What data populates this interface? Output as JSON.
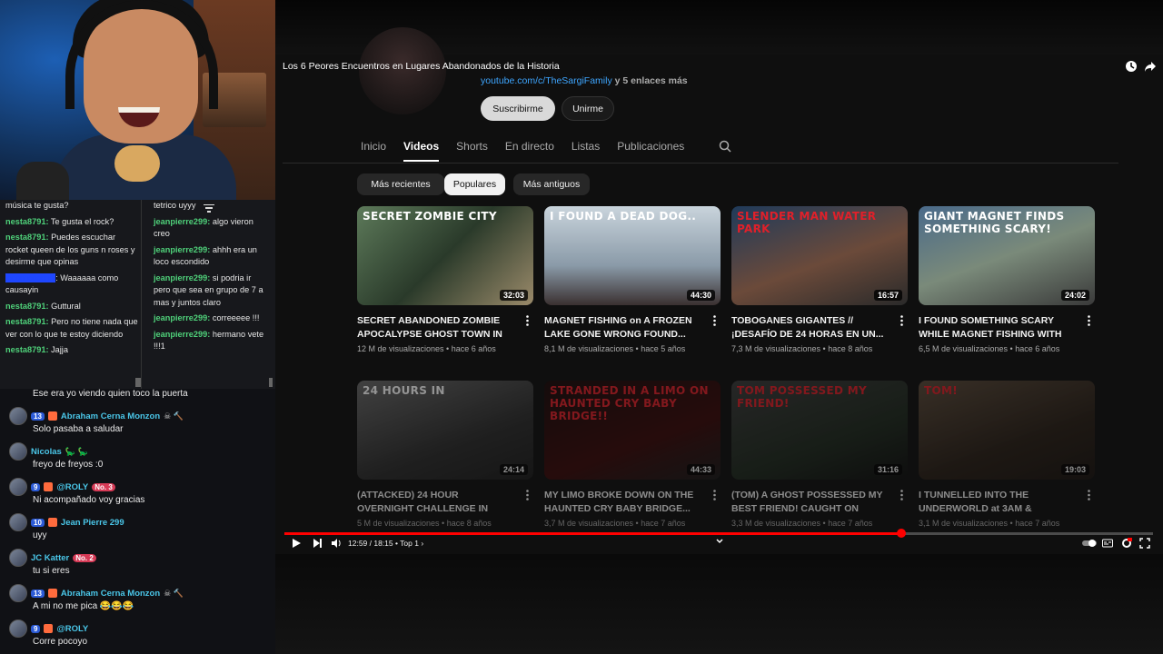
{
  "chat_top": {
    "left": [
      {
        "user": "",
        "text": "música te gusta?"
      },
      {
        "user": "nesta8791:",
        "text": "Te gusta el rock?"
      },
      {
        "user": "nesta8791:",
        "text": "Puedes escuchar rocket queen de los guns n roses y desirme que opinas"
      },
      {
        "user": "",
        "text": "Waaaaaa como causayin",
        "hidden_user": "xxxxxxxxxxxx"
      },
      {
        "user": "nesta8791:",
        "text": "Guttural"
      },
      {
        "user": "nesta8791:",
        "text": "Pero no tiene nada que ver con lo que te estoy diciendo"
      },
      {
        "user": "nesta8791:",
        "text": "Jajja"
      }
    ],
    "right": [
      {
        "user": "",
        "text": "tetrico uyyy"
      },
      {
        "user": "jeanpierre299:",
        "text": "algo vieron creo"
      },
      {
        "user": "jeanpierre299:",
        "text": "ahhh era un loco escondido"
      },
      {
        "user": "jeanpierre299:",
        "text": "si podria ir pero que sea en grupo de 7 a mas y juntos claro"
      },
      {
        "user": "jeanpierre299:",
        "text": "correeeee !!!"
      },
      {
        "user": "jeanpierre299:",
        "text": "hermano vete !!!1"
      }
    ]
  },
  "chat_bottom": {
    "first_line": "Ese era yo viendo quien toco la puerta",
    "messages": [
      {
        "level": "13",
        "name": "Abraham Cerna Monzon",
        "no": "",
        "extra": "☠ 🔨",
        "text": "Solo pasaba a saludar"
      },
      {
        "level": "",
        "name": "Nicolas",
        "no": "",
        "extra": "🦕 🦕",
        "text": "freyo de freyos :0"
      },
      {
        "level": "9",
        "name": "@ROLY",
        "no": "No. 3",
        "extra": "",
        "text": "Ni acompañado voy gracias"
      },
      {
        "level": "10",
        "name": "Jean Pierre 299",
        "no": "",
        "extra": "",
        "text": "uyy"
      },
      {
        "level": "",
        "name": "JC Katter",
        "no": "No. 2",
        "extra": "",
        "text": "tu si eres"
      },
      {
        "level": "13",
        "name": "Abraham Cerna Monzon",
        "no": "",
        "extra": "☠ 🔨",
        "text": "A mi no me pica 😂😂😂"
      },
      {
        "level": "9",
        "name": "@ROLY",
        "no": "",
        "extra": "",
        "text": "Corre pocoyo"
      }
    ]
  },
  "player": {
    "video_title": "Los 6 Peores Encuentros en Lugares Abandonados de la Historia",
    "time": "12:59 / 18:15 • Top 1 ›",
    "progress": 0.71
  },
  "channel": {
    "link": "youtube.com/c/TheSargiFamily",
    "more_links": "y 5 enlaces más",
    "subscribe": "Suscribirme",
    "join": "Unirme"
  },
  "tabs": [
    "Inicio",
    "Videos",
    "Shorts",
    "En directo",
    "Listas",
    "Publicaciones"
  ],
  "chips": [
    "Más recientes",
    "Populares",
    "Más antiguos"
  ],
  "videos": [
    {
      "thumb_text": "SECRET ZOMBIE CITY",
      "duration": "32:03",
      "title": "SECRET ABANDONED ZOMBIE APOCALYPSE GHOST TOWN IN T...",
      "meta": "12 M de visualizaciones • hace 6 años"
    },
    {
      "thumb_text": "I FOUND A DEAD DOG..",
      "duration": "44:30",
      "title": "MAGNET FISHING on A FROZEN LAKE GONE WRONG FOUND...",
      "meta": "8,1 M de visualizaciones • hace 5 años"
    },
    {
      "thumb_text": "SLENDER MAN WATER PARK",
      "duration": "16:57",
      "title": "TOBOGANES GIGANTES // ¡DESAFÍO DE 24 HORAS EN UN...",
      "meta": "7,3 M de visualizaciones • hace 8 años"
    },
    {
      "thumb_text": "GIANT MAGNET FINDS SOMETHING SCARY!",
      "duration": "24:02",
      "title": "I FOUND SOMETHING SCARY WHILE MAGNET FISHING WITH A...",
      "meta": "6,5 M de visualizaciones • hace 6 años"
    },
    {
      "thumb_text": "24 HOURS IN",
      "duration": "24:14",
      "title": "(ATTACKED) 24 HOUR OVERNIGHT CHALLENGE IN ABANDONED...",
      "meta": "5 M de visualizaciones • hace 8 años"
    },
    {
      "thumb_text": "STRANDED IN A LIMO ON HAUNTED CRY BABY BRIDGE!!",
      "duration": "44:33",
      "title": "MY LIMO BROKE DOWN ON THE HAUNTED CRY BABY BRIDGE...",
      "meta": "3,7 M de visualizaciones • hace 7 años"
    },
    {
      "thumb_text": "TOM POSSESSED MY FRIEND!",
      "duration": "31:16",
      "title": "(TOM) A GHOST POSSESSED MY BEST FRIEND! CAUGHT ON FILM! |...",
      "meta": "3,3 M de visualizaciones • hace 7 años"
    },
    {
      "thumb_text": "TOM!",
      "duration": "19:03",
      "title": "I TUNNELLED INTO THE UNDERWORLD at 3AM & FOUND...",
      "meta": "3,1 M de visualizaciones • hace 7 años"
    }
  ]
}
